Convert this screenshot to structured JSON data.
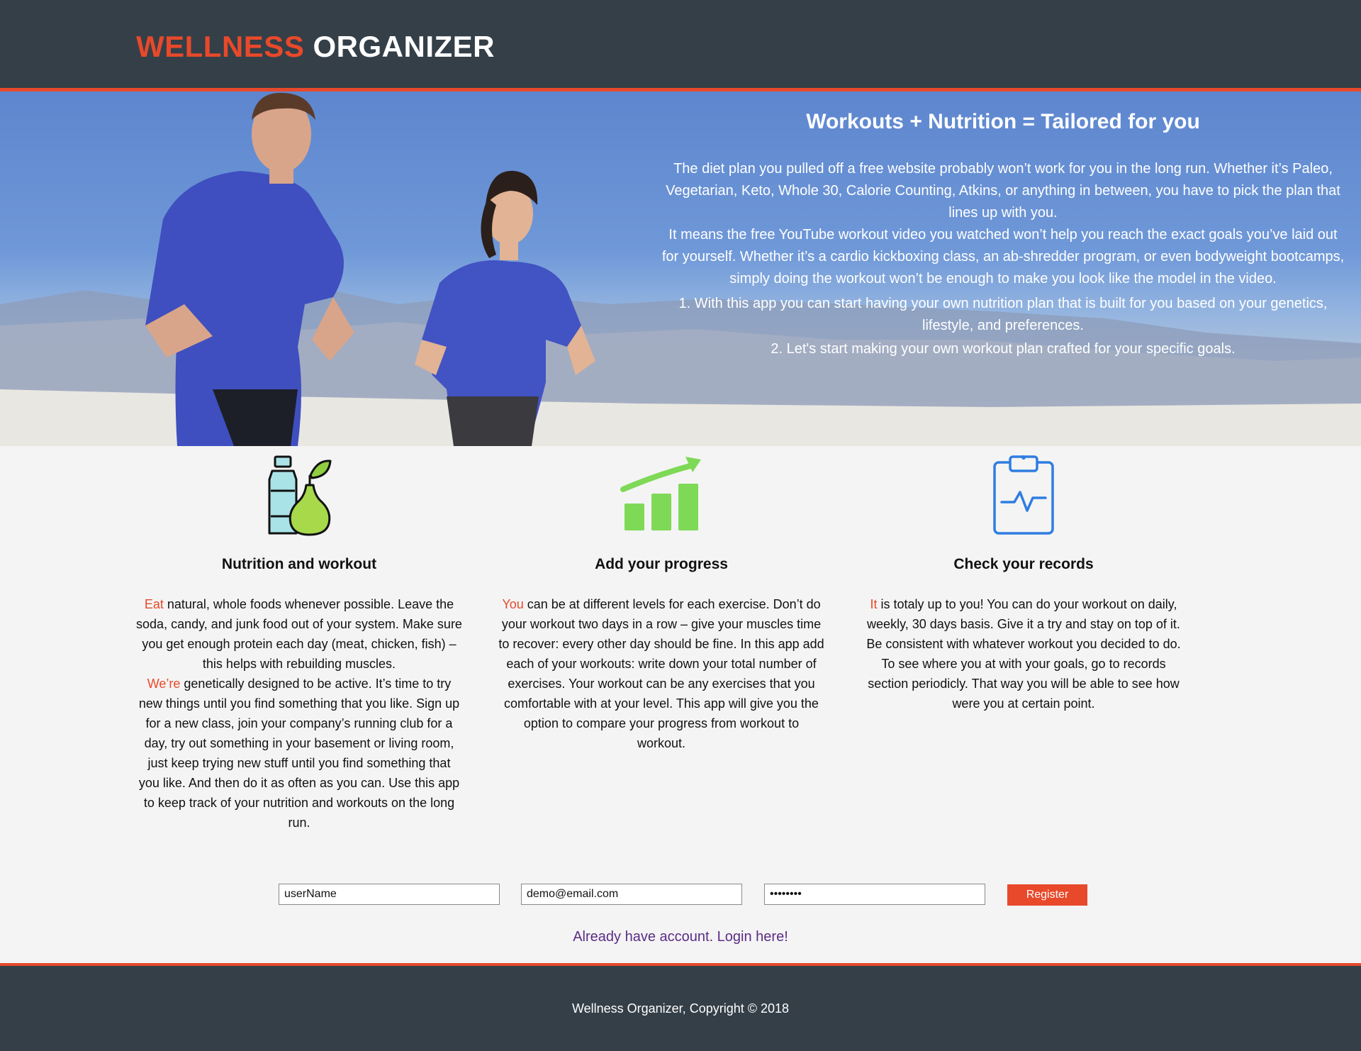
{
  "header": {
    "logo_accent": "WELLNESS",
    "logo_main": "ORGANIZER"
  },
  "hero": {
    "title": "Workouts + Nutrition = Tailored for you",
    "paragraph1": "The diet plan you pulled off a free website probably won’t work for you in the long run. Whether it’s Paleo, Vegetarian, Keto, Whole 30, Calorie Counting, Atkins, or anything in between, you have to pick the plan that lines up with you.",
    "paragraph2": "It means the free YouTube workout video you watched won’t help you reach the exact goals you’ve laid out for yourself. Whether it’s a cardio kickboxing class, an ab-shredder program, or even bodyweight bootcamps, simply doing the workout won’t be enough to make you look like the model in the video.",
    "list": [
      "1. With this app you can start having your own nutrition plan that is built for you based on your genetics, lifestyle, and preferences.",
      "2. Let's start making your own workout plan crafted for your specific goals."
    ]
  },
  "features": [
    {
      "icon": "nutrition-icon",
      "title": "Nutrition and workout",
      "p1_accent": "Eat",
      "p1_rest": " natural, whole foods whenever possible. Leave the soda, candy, and junk food out of your system. Make sure you get enough protein each day (meat, chicken, fish) – this helps with rebuilding muscles.",
      "p2_accent": "We’re",
      "p2_rest": " genetically designed to be active. It’s time to try new things until you find something that you like. Sign up for a new class, join your company’s running club for a day, try out something in your basement or living room, just keep trying new stuff until you find something that you like. And then do it as often as you can. Use this app to keep track of your nutrition and workouts on the long run."
    },
    {
      "icon": "progress-chart-icon",
      "title": "Add your progress",
      "p1_accent": "You",
      "p1_rest": " can be at different levels for each exercise. Don’t do your workout two days in a row – give your muscles time to recover: every other day should be fine. In this app add each of your workouts: write down your total number of exercises. Your workout can be any exercises that you comfortable with at your level. This app will give you the option to compare your progress from workout to workout."
    },
    {
      "icon": "clipboard-icon",
      "title": "Check your records",
      "p1_accent": "It",
      "p1_rest": " is totaly up to you! You can do your workout on daily, weekly, 30 days basis. Give it a try and stay on top of it. Be consistent with whatever workout you decided to do. To see where you at with your goals, go to records section periodicly. That way you will be able to see how were you at certain point."
    }
  ],
  "form": {
    "username_value": "userName",
    "email_value": "demo@email.com",
    "password_value": "password",
    "register_label": "Register",
    "login_text": "Already have account. Login here!"
  },
  "footer": {
    "copyright": "Wellness Organizer, Copyright © 2018"
  },
  "colors": {
    "accent": "#e8492a",
    "header_bg": "#343f48",
    "link": "#5b2d86"
  }
}
